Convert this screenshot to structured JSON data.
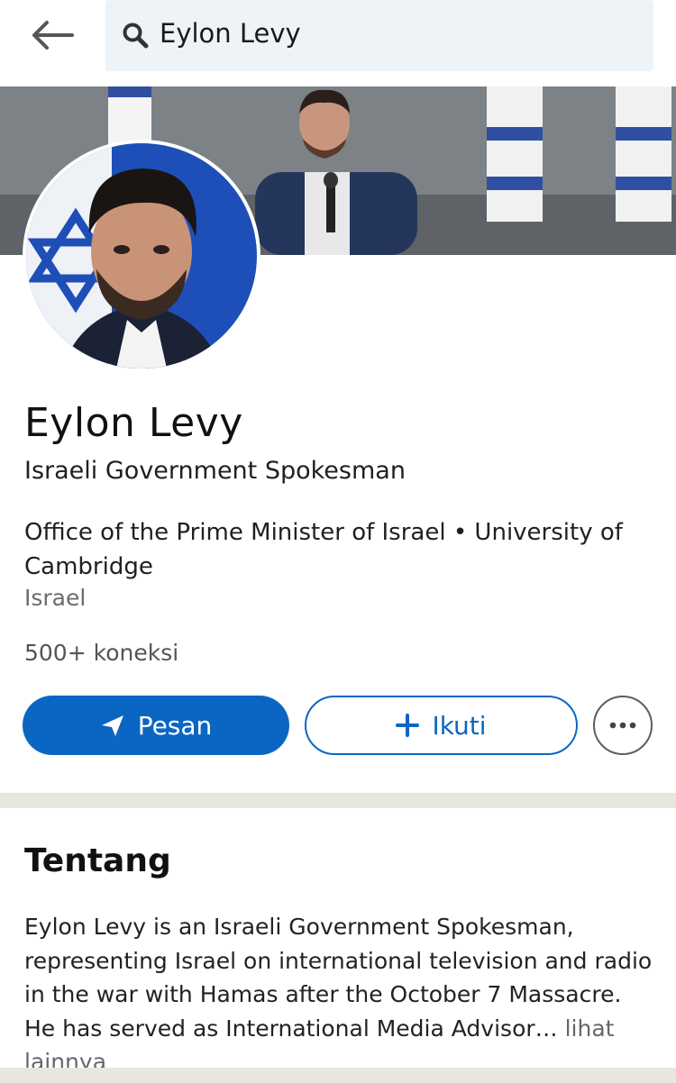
{
  "search": {
    "query": "Eylon Levy"
  },
  "profile": {
    "name": "Eylon Levy",
    "headline": "Israeli Government Spokesman",
    "org_line": "Office of the Prime Minister of Israel • University of Cambridge",
    "location": "Israel",
    "connections": "500+ koneksi"
  },
  "actions": {
    "message_label": "Pesan",
    "follow_label": "Ikuti",
    "more_label": "···"
  },
  "about": {
    "title": "Tentang",
    "text": "Eylon Levy is an Israeli Government Spokesman, representing Israel on international television and radio in the war with Hamas after the October 7 Massacre. He has served as International Media Advisor",
    "ellipsis": "…",
    "see_more": "lihat lainnya"
  },
  "colors": {
    "accent": "#0a66c2",
    "search_bg": "#eef3f8",
    "divider": "#e9e5df"
  },
  "icons": {
    "back": "arrow-left-icon",
    "search": "search-icon",
    "send": "send-icon",
    "plus": "plus-icon",
    "more": "more-horizontal-icon"
  }
}
